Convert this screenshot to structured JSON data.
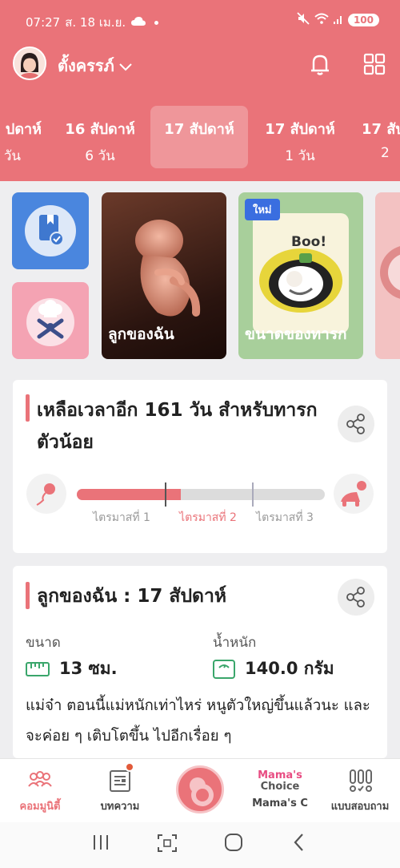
{
  "status_bar": {
    "time": "07:27",
    "date": "ส. 18 เม.ย.",
    "battery": "100"
  },
  "topbar": {
    "mode_label": "ตั้งครรภ์"
  },
  "weeks": [
    {
      "line1": "ปดาห์",
      "line2": "วัน"
    },
    {
      "line1": "16 สัปดาห์",
      "line2": "6 วัน"
    },
    {
      "line1": "17 สัปดาห์",
      "line2": ""
    },
    {
      "line1": "17 สัปดาห์",
      "line2": "1 วัน"
    },
    {
      "line1": "17 สัป",
      "line2": "2"
    }
  ],
  "cards": {
    "baby_label": "ลูกของฉัน",
    "size_label": "ขนาดของทารก",
    "new_badge": "ใหม่",
    "boo_text": "Boo!"
  },
  "countdown": {
    "title": "เหลือเวลาอีก 161 วัน สำหรับทารกตัวน้อย",
    "progress_fraction": 0.42,
    "trimesters": [
      "ไตรมาสที่ 1",
      "ไตรมาสที่ 2",
      "ไตรมาสที่ 3"
    ],
    "active_trimester_color": "#ea7379"
  },
  "baby_info": {
    "title": "ลูกของฉัน :  17 สัปดาห์",
    "size_label": "ขนาด",
    "size_value": "13 ซม.",
    "weight_label": "น้ำหนัก",
    "weight_value": "140.0 กรัม",
    "description": "แม่จ๋า ตอนนี้แม่หนักเท่าไหร่ หนูตัวใหญ่ขึ้นแล้วนะ และจะค่อย ๆ เติบโตขึ้น ไปอีกเรื่อย ๆ"
  },
  "bottom_nav": {
    "community": "คอมมูนิตี้",
    "articles": "บทความ",
    "mamas_choice_logo_1": "Mama's",
    "mamas_choice_logo_2": "Choice",
    "mamas_choice": "Mama's C",
    "quiz": "แบบสอบถาม"
  },
  "colors": {
    "brand": "#ea7379",
    "blue_card": "#4a86de",
    "pink_card": "#f4a3b3",
    "green_icon": "#3aa66b"
  }
}
